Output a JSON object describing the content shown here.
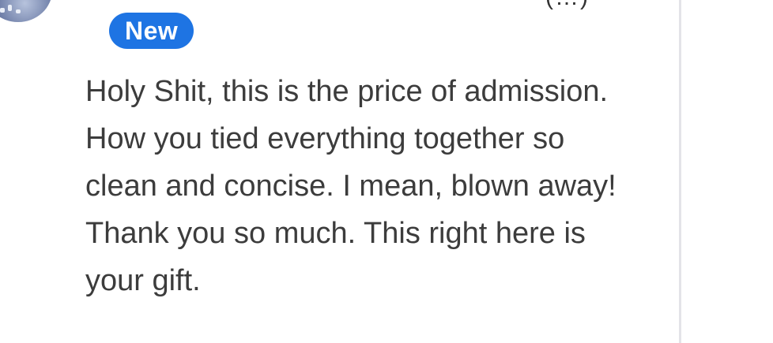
{
  "comment": {
    "badge_label": "New",
    "header_fragment": "(…)",
    "text": "Holy Shit, this is the price of admission. How you tied everything together so clean and concise. I mean, blown away! Thank you so much. This right here is your gift."
  },
  "colors": {
    "badge_bg": "#1e74e3",
    "text": "#3c3c3c",
    "divider": "#e3e3e8"
  },
  "icons": {
    "avatar": "user-avatar"
  }
}
